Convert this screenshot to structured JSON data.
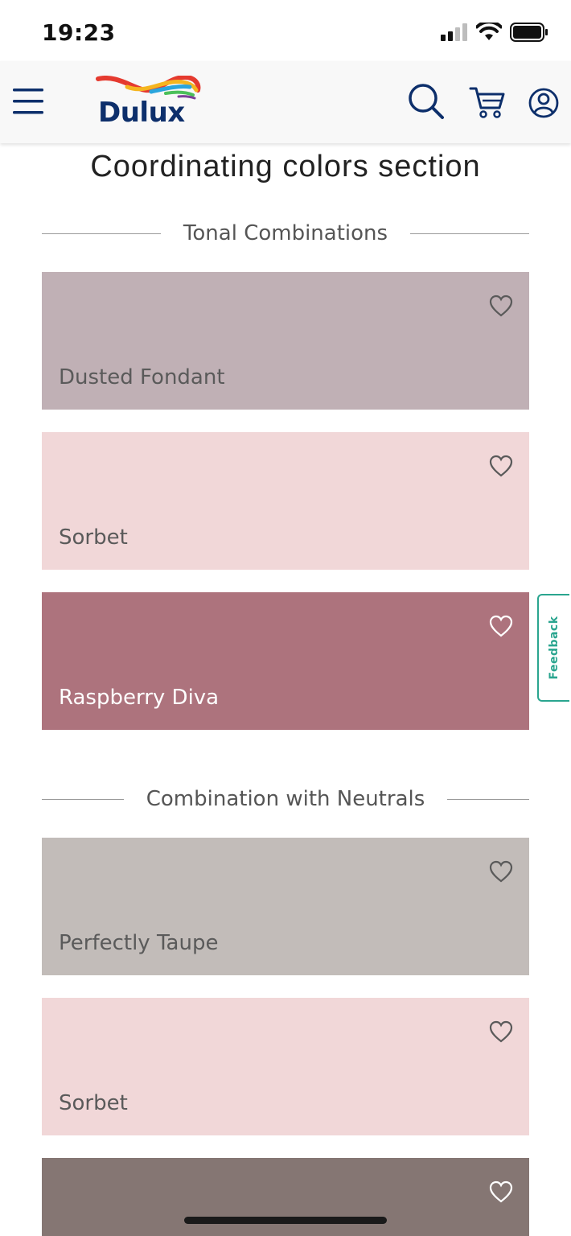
{
  "status_bar": {
    "time": "19:23"
  },
  "header": {
    "logo_text": "Dulux",
    "icons": [
      "menu-icon",
      "search-icon",
      "cart-icon",
      "account-icon"
    ]
  },
  "page_title": "Coordinating colors section",
  "sections": [
    {
      "heading": "Tonal Combinations",
      "colors": [
        {
          "name": "Dusted Fondant",
          "hex": "#c0b0b5"
        },
        {
          "name": "Sorbet",
          "hex": "#f1d7d8"
        },
        {
          "name": "Raspberry Diva",
          "hex": "#ad737d"
        }
      ]
    },
    {
      "heading": "Combination with Neutrals",
      "colors": [
        {
          "name": "Perfectly Taupe",
          "hex": "#c2bcb9"
        },
        {
          "name": "Sorbet",
          "hex": "#f1d7d8"
        },
        {
          "name": "",
          "hex": "#857673"
        }
      ]
    }
  ],
  "feedback_tab": {
    "label": "Feedback"
  },
  "colors": {
    "brand_navy": "#0d2f6b",
    "feedback_teal": "#2aa58f"
  }
}
